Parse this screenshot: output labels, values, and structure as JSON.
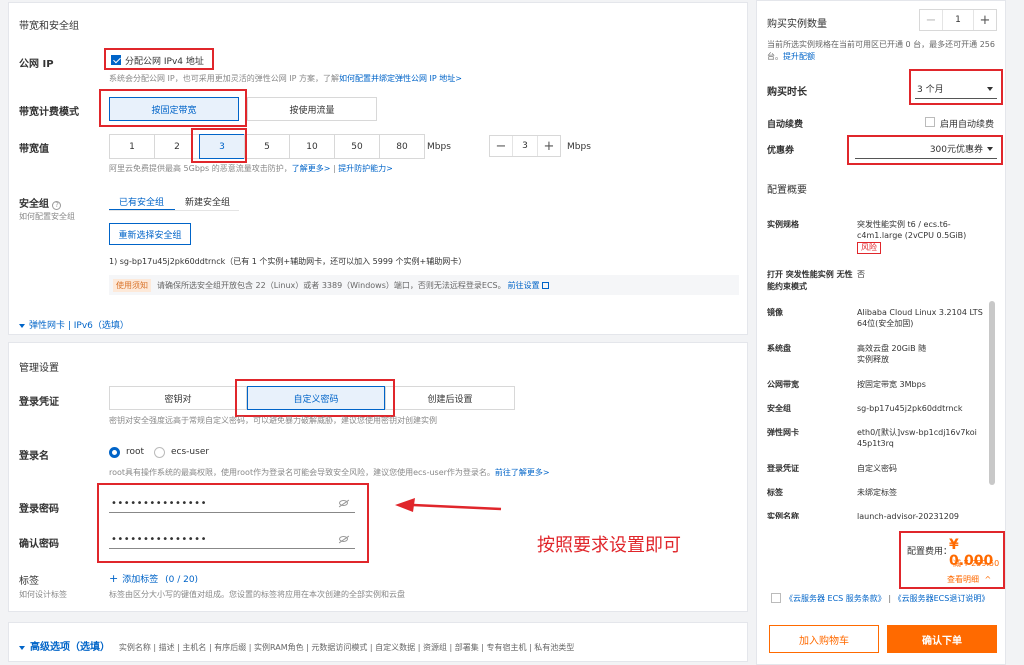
{
  "bandwidth": {
    "section_title": "带宽和安全组",
    "public_ip_label": "公网 IP",
    "public_ip_checkbox": "分配公网 IPv4 地址",
    "public_ip_hint": "系统会分配公网 IP，也可采用更加灵活的弹性公网 IP 方案，了解",
    "public_ip_link": "如何配置并绑定弹性公网 IP 地址>",
    "billing_label": "带宽计费模式",
    "billing_options": [
      "按固定带宽",
      "按使用流量"
    ],
    "value_label": "带宽值",
    "value_options": [
      "1",
      "2",
      "3",
      "5",
      "10",
      "50",
      "80"
    ],
    "unit": "Mbps",
    "custom_value": "3",
    "value_hint": "阿里云免费提供最高 5Gbps 的恶意流量攻击防护，",
    "value_link1": "了解更多>",
    "value_sep": " | ",
    "value_link2": "提升防护能力>",
    "sg_label": "安全组",
    "sg_sub": "如何配置安全组",
    "sg_tabs": [
      "已有安全组",
      "新建安全组"
    ],
    "sg_reselect": "重新选择安全组",
    "sg_selected": "1) sg-bp17u45j2pk60ddtrnck（已有 1 个实例+辅助网卡，还可以加入 5999 个实例+辅助网卡）",
    "notice_tag": "使用须知",
    "notice_text": "请确保所选安全组开放包含 22（Linux）或者 3389（Windows）端口，否则无法远程登录ECS。",
    "notice_link": "前往设置",
    "eni_toggle": "弹性网卡 | IPv6（选填）"
  },
  "management": {
    "section_title": "管理设置",
    "credential_label": "登录凭证",
    "credential_options": [
      "密钥对",
      "自定义密码",
      "创建后设置"
    ],
    "credential_hint": "密钥对安全强度远高于常规自定义密码，可以避免暴力破解威胁，建议您使用密钥对创建实例",
    "login_name_label": "登录名",
    "login_name_options": [
      "root",
      "ecs-user"
    ],
    "login_name_hint": "root具有操作系统的最高权限，使用root作为登录名可能会导致安全风险，建议您使用ecs-user作为登录名。",
    "login_name_link": "前往了解更多>",
    "password_label": "登录密码",
    "password_value": "•••••••••••••••",
    "confirm_label": "确认密码",
    "confirm_value": "•••••••••••••••",
    "annotation": "按照要求设置即可",
    "tag_label": "标签",
    "tag_sub": "如何设计标签",
    "tag_add": "添加标签",
    "tag_count": "(0 / 20)",
    "tag_hint": "标签由区分大小写的键值对组成。您设置的标签将应用在本次创建的全部实例和云盘"
  },
  "advanced": {
    "title": "高级选项（选填）",
    "items": "实例名称 | 描述 | 主机名 | 有序后缀 | 实例RAM角色 | 元数据访问模式 | 自定义数据 | 资源组 | 部署集 | 专有宿主机 | 私有池类型"
  },
  "sidebar": {
    "qty_label": "购买实例数量",
    "qty_value": "1",
    "qty_hint": "当前所选实例规格在当前可用区已开通 0 台，最多还可开通 256 台。",
    "qty_link": "提升配额",
    "duration_label": "购买时长",
    "duration_value": "3 个月",
    "renew_label": "自动续费",
    "renew_checkbox": "启用自动续费",
    "coupon_label": "优惠券",
    "coupon_value": "300元优惠券",
    "summary_title": "配置概要",
    "summary": [
      {
        "k": "实例规格",
        "v": "突发性能实例 t6 / ecs.t6-c4m1.large (2vCPU 0.5GiB)"
      },
      {
        "k": "打开 突发性能实例 无性能约束模式",
        "v": "否"
      },
      {
        "k": "镜像",
        "v": "Alibaba Cloud Linux 3.2104 LTS 64位(安全加固)"
      },
      {
        "k": "系统盘",
        "v": "高效云盘 20GiB 随实例释放"
      },
      {
        "k": "公网带宽",
        "v": "按固定带宽 3Mbps"
      },
      {
        "k": "安全组",
        "v": "sg-bp17u45j2pk60ddtrnck"
      },
      {
        "k": "弹性网卡",
        "v": "eth0/[默认]vsw-bp1cdj16v7koi45p1t3rq"
      },
      {
        "k": "登录凭证",
        "v": "自定义密码"
      },
      {
        "k": "标签",
        "v": "未绑定标签"
      },
      {
        "k": "实例名称",
        "v": "launch-advisor-20231209"
      }
    ],
    "risk_tag": "风险",
    "price_label": "配置费用：",
    "price_value": "¥ 0.000",
    "discount": "减 ¥ 259.50",
    "detail_link": "查看明细",
    "agree_link1": "《云服务器 ECS 服务条款》",
    "agree_sep": "|",
    "agree_link2": "《云服务器ECS退订说明》",
    "cart_button": "加入购物车",
    "order_button": "确认下单"
  },
  "colors": {
    "accent": "#0064c8",
    "orange": "#ff6a00",
    "red": "#e0262b"
  }
}
